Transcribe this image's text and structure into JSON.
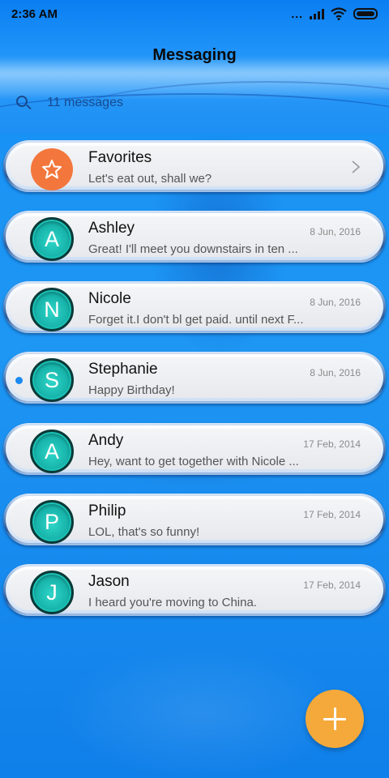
{
  "status_bar": {
    "time": "2:36 AM",
    "dots": "..."
  },
  "header": {
    "title": "Messaging",
    "search_placeholder": "11 messages"
  },
  "conversations": [
    {
      "name": "Favorites",
      "snippet": "Let's eat out, shall we?",
      "date": "",
      "avatar_letter": "",
      "avatar_type": "favorites",
      "unread": false
    },
    {
      "name": "Ashley",
      "snippet": "Great! I'll meet you downstairs in ten ...",
      "date": "8 Jun, 2016",
      "avatar_letter": "A",
      "unread": false
    },
    {
      "name": "Nicole",
      "snippet": "Forget it.I don't bl get paid. until next F...",
      "date": "8 Jun, 2016",
      "avatar_letter": "N",
      "unread": false
    },
    {
      "name": "Stephanie",
      "snippet": "Happy Birthday!",
      "date": "8 Jun, 2016",
      "avatar_letter": "S",
      "unread": true
    },
    {
      "name": "Andy",
      "snippet": "Hey, want to get together with Nicole ...",
      "date": "17 Feb, 2014",
      "avatar_letter": "A",
      "unread": false
    },
    {
      "name": "Philip",
      "snippet": "LOL, that's so funny!",
      "date": "17 Feb, 2014",
      "avatar_letter": "P",
      "unread": false
    },
    {
      "name": "Jason",
      "snippet": "I heard you're moving to China.",
      "date": "17 Feb, 2014",
      "avatar_letter": "J",
      "unread": false
    }
  ],
  "colors": {
    "accent": "#1a8af0",
    "fab": "#f5a93a",
    "favorites_avatar": "#f3773d",
    "avatar_teal": "#17b3aa"
  }
}
